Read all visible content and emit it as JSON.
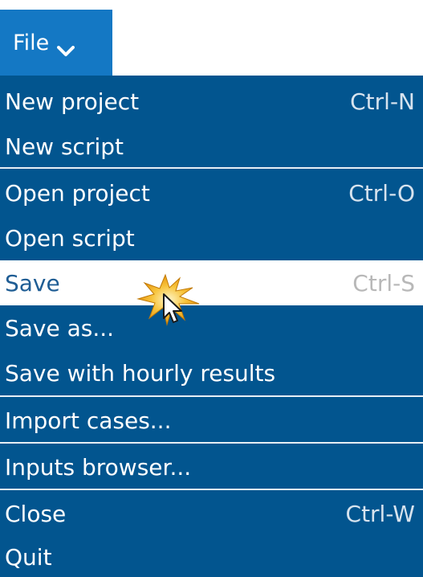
{
  "file_tab": {
    "label": "File",
    "chevron_icon": "chevron-down-icon"
  },
  "menu": {
    "items": [
      {
        "label": "New project",
        "shortcut": "Ctrl-N"
      },
      {
        "label": "New script",
        "shortcut": ""
      },
      {
        "label": "Open project",
        "shortcut": "Ctrl-O"
      },
      {
        "label": "Open script",
        "shortcut": ""
      },
      {
        "label": "Save",
        "shortcut": "Ctrl-S",
        "state": "highlighted"
      },
      {
        "label": "Save as...",
        "shortcut": ""
      },
      {
        "label": "Save with hourly results",
        "shortcut": ""
      },
      {
        "label": "Import cases...",
        "shortcut": ""
      },
      {
        "label": "Inputs browser...",
        "shortcut": ""
      },
      {
        "label": "Close",
        "shortcut": "Ctrl-W"
      },
      {
        "label": "Quit",
        "shortcut": ""
      }
    ]
  },
  "cursor": {
    "icon": "mouse-pointer-icon",
    "highlight": "click-burst-icon"
  },
  "colors": {
    "tab_bg": "#1478c4",
    "menu_bg": "#02558f",
    "menu_text": "#ffffff",
    "active_bg": "#ffffff",
    "active_text": "#1f5d94",
    "shortcut_text": "#d7e3ee",
    "separator": "#e7eef5",
    "cursor_burst": "#f0a820"
  }
}
